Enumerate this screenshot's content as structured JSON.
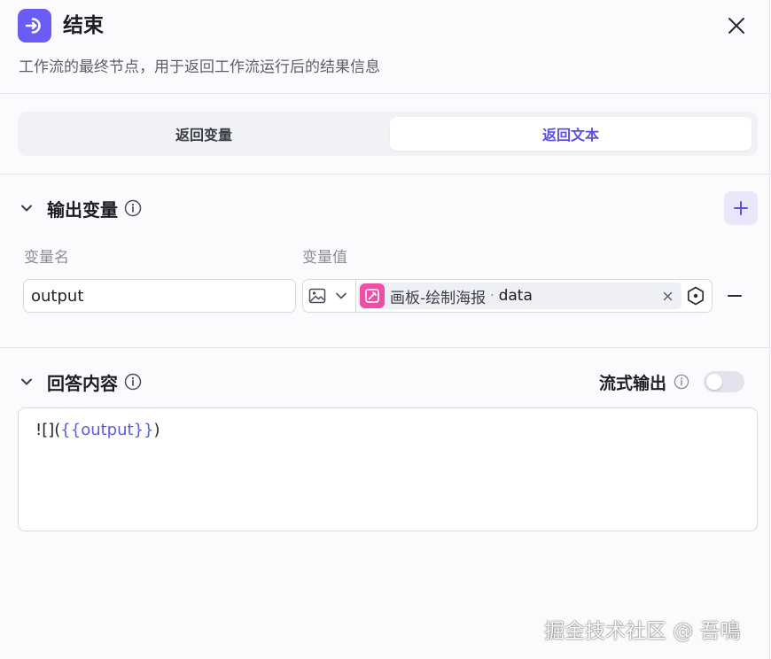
{
  "header": {
    "title": "结束",
    "description": "工作流的最终节点，用于返回工作流运行后的结果信息",
    "node_icon": "exit-node-icon",
    "close_icon": "close-icon",
    "accent": "#6b5cf6"
  },
  "tabs": [
    {
      "label": "返回变量",
      "active": false
    },
    {
      "label": "返回文本",
      "active": true
    }
  ],
  "output_section": {
    "title": "输出变量",
    "col_name_label": "变量名",
    "col_value_label": "变量值",
    "rows": [
      {
        "name": "output",
        "type_icon": "image-icon",
        "ref_node": "画板-绘制海报",
        "ref_separator": "·",
        "ref_field": "data",
        "ref_badge_color": "#ee4fa5"
      }
    ]
  },
  "answer_section": {
    "title": "回答内容",
    "stream_label": "流式输出",
    "stream_enabled": false,
    "content_prefix": "![](",
    "content_var": "{{output}}",
    "content_suffix": ")"
  },
  "watermark": "掘金技术社区 @ 吾鳴"
}
